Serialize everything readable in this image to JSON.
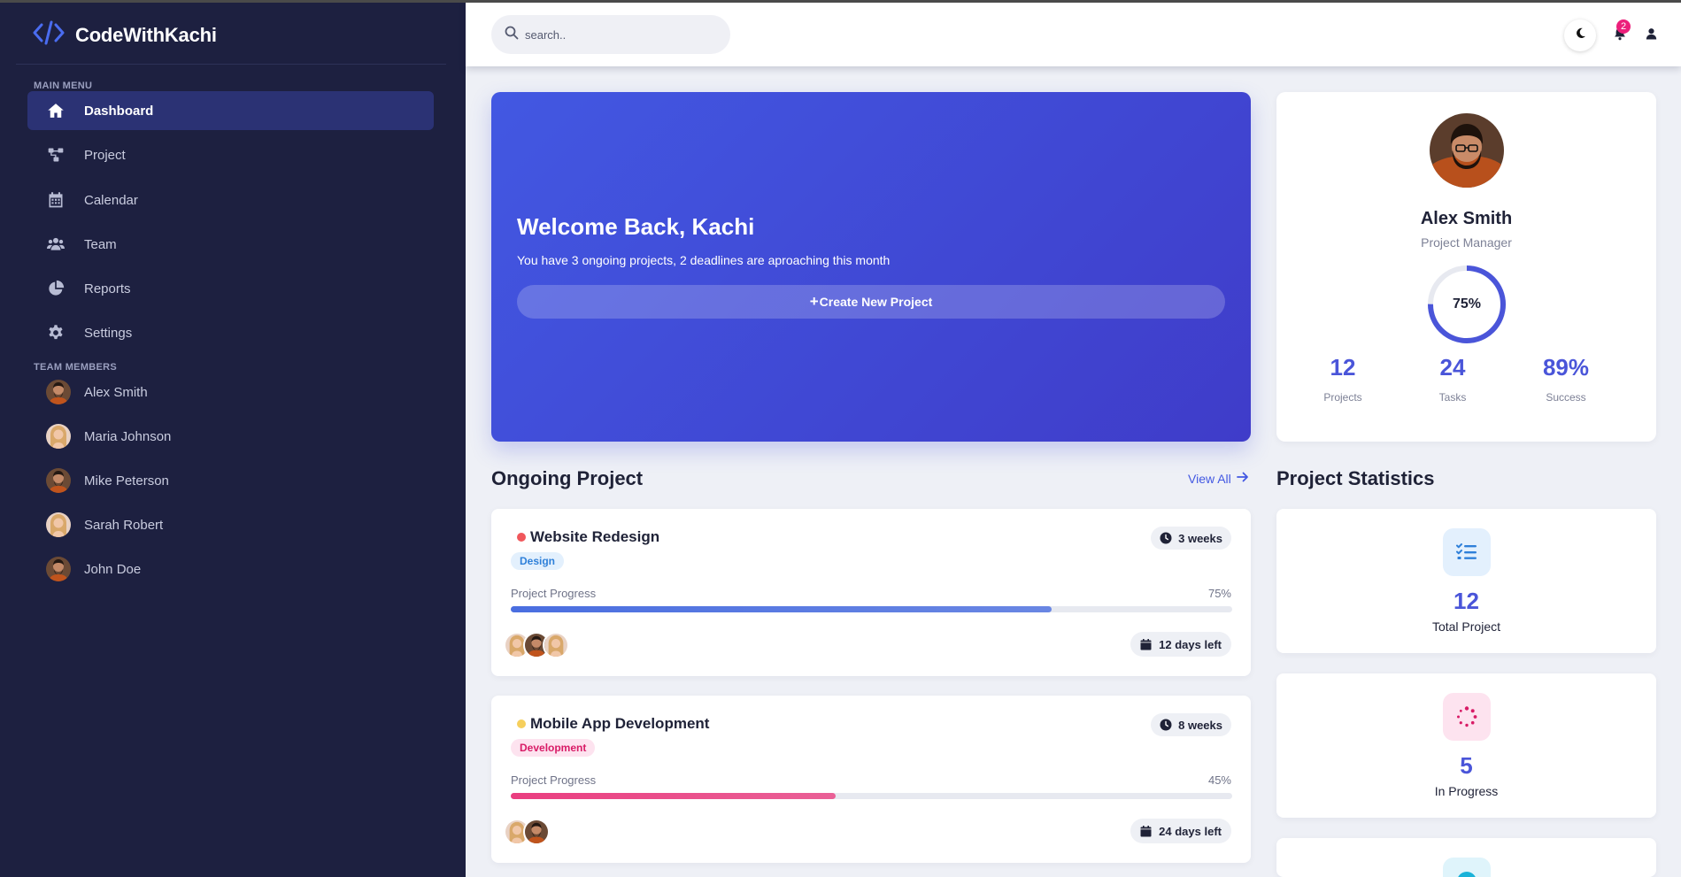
{
  "brand": {
    "name": "CodeWithKachi"
  },
  "sidebar": {
    "main_menu_label": "MAIN MENU",
    "nav": [
      {
        "label": "Dashboard",
        "icon": "home-icon",
        "active": true
      },
      {
        "label": "Project",
        "icon": "project-icon",
        "active": false
      },
      {
        "label": "Calendar",
        "icon": "calendar-icon",
        "active": false
      },
      {
        "label": "Team",
        "icon": "team-icon",
        "active": false
      },
      {
        "label": "Reports",
        "icon": "pie-chart-icon",
        "active": false
      },
      {
        "label": "Settings",
        "icon": "gear-icon",
        "active": false
      }
    ],
    "team_label": "TEAM MEMBERS",
    "members": [
      {
        "name": "Alex Smith"
      },
      {
        "name": "Maria Johnson"
      },
      {
        "name": "Mike Peterson"
      },
      {
        "name": "Sarah Robert"
      },
      {
        "name": "John Doe"
      }
    ]
  },
  "header": {
    "search_placeholder": "search..",
    "notification_count": "2"
  },
  "welcome": {
    "title": "Welcome Back, Kachi",
    "subtitle": "You have 3 ongoing projects, 2 deadlines are aproaching this month",
    "button_plus": "+",
    "button_label": "Create New Project"
  },
  "profile": {
    "name": "Alex Smith",
    "role": "Project Manager",
    "progress_label": "75%",
    "progress_value": 0.75,
    "stats": [
      {
        "value": "12",
        "label": "Projects"
      },
      {
        "value": "24",
        "label": "Tasks"
      },
      {
        "value": "89%",
        "label": "Success"
      }
    ]
  },
  "ongoing": {
    "title": "Ongoing Project",
    "view_all": "View All",
    "projects": [
      {
        "title": "Website Redesign",
        "dot_color": "#f0575b",
        "tag": "Design",
        "tag_bg": "#e3f0fd",
        "tag_color": "#2f80d9",
        "duration": "3 weeks",
        "progress_label": "Project Progress",
        "progress_text": "75%",
        "progress": 0.75,
        "bar_color": "#4a6ee0",
        "days_left": "12 days left"
      },
      {
        "title": "Mobile App Development",
        "dot_color": "#f6cf5c",
        "tag": "Development",
        "tag_bg": "#fde3ef",
        "tag_color": "#d81b66",
        "duration": "8 weeks",
        "progress_label": "Project Progress",
        "progress_text": "45%",
        "progress": 0.45,
        "bar_color": "#ea3e80",
        "days_left": "24 days left"
      }
    ]
  },
  "statistics": {
    "title": "Project Statistics",
    "cards": [
      {
        "value": "12",
        "label": "Total Project",
        "icon": "task-list-icon",
        "icon_bg": "#e3f0fd",
        "icon_color": "#2f80d9"
      },
      {
        "value": "5",
        "label": "In Progress",
        "icon": "spinner-icon",
        "icon_bg": "#fde3ef",
        "icon_color": "#d81b66"
      },
      {
        "icon": "check-circle-icon",
        "icon_bg": "#dff4fb",
        "icon_color": "#1ab2d8"
      }
    ]
  },
  "colors": {
    "sidebar_bg": "#1d2040",
    "accent": "#4258e2",
    "active_nav": "#2b3274",
    "page_bg": "#eef0f6"
  }
}
